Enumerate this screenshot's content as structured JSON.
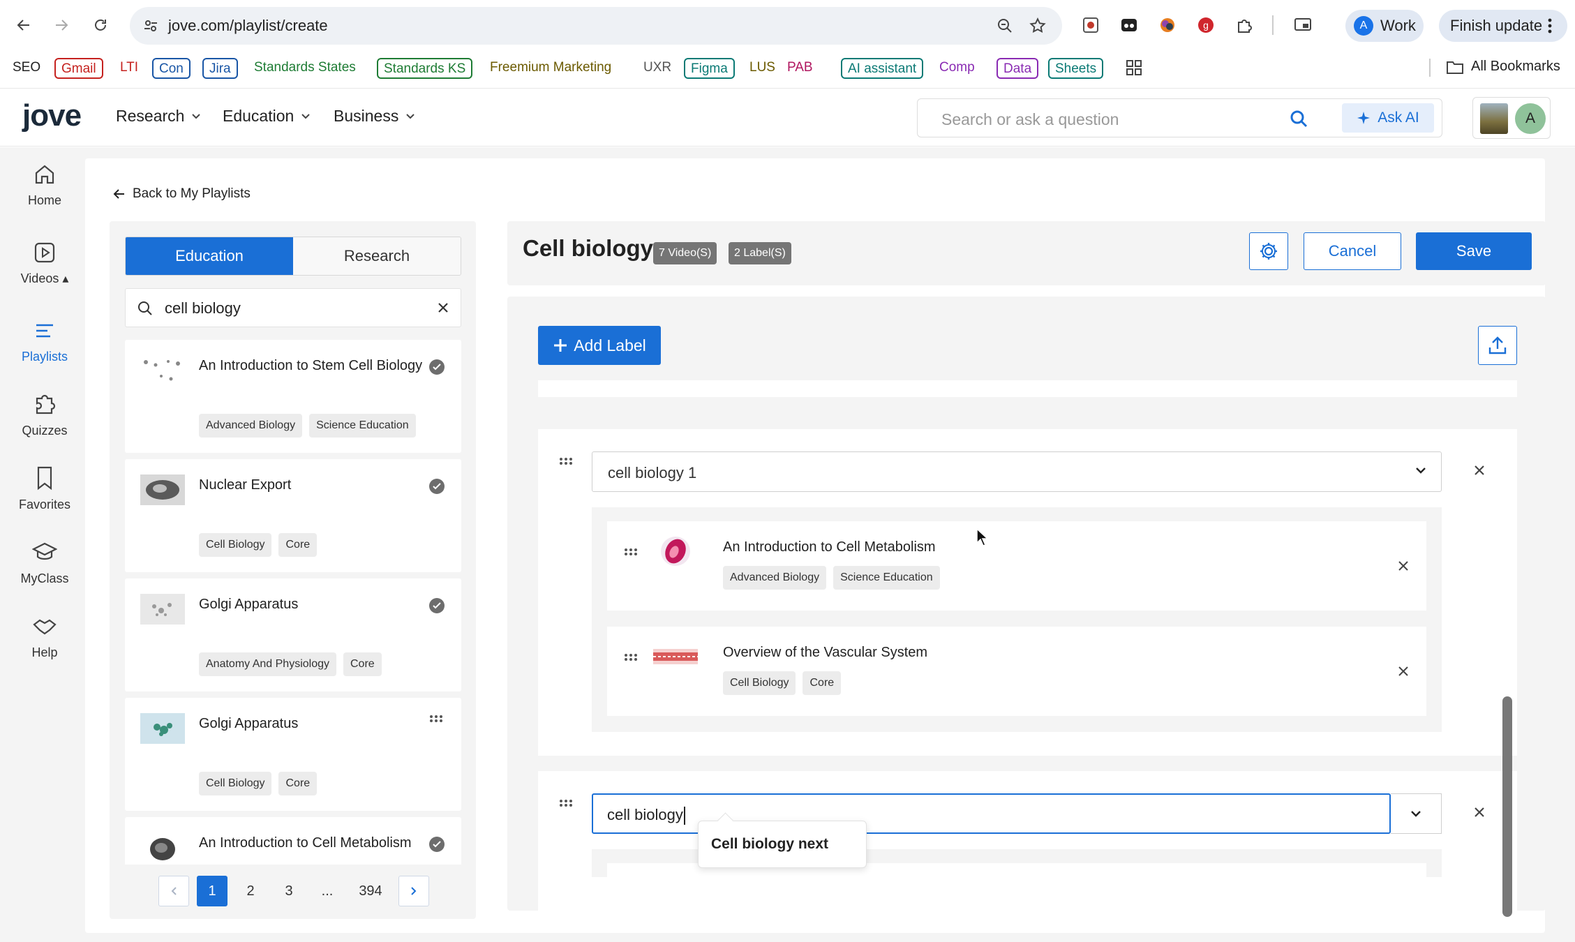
{
  "browser": {
    "url": "jove.com/playlist/create",
    "profile_label": "Work",
    "profile_initial": "A",
    "finish_update_label": "Finish update",
    "all_bookmarks_label": "All Bookmarks",
    "bookmarks": [
      {
        "label": "SEO",
        "color": "#222222",
        "boxed": false
      },
      {
        "label": "Gmail",
        "color": "#c5221f",
        "boxed": true
      },
      {
        "label": "LTI",
        "color": "#c5221f",
        "boxed": false
      },
      {
        "label": "Con",
        "color": "#1a56a6",
        "boxed": true
      },
      {
        "label": "Jira",
        "color": "#1a56a6",
        "boxed": true
      },
      {
        "label": "Standards States",
        "color": "#1e7c34",
        "boxed": false
      },
      {
        "label": "Standards KS",
        "color": "#1e7c34",
        "boxed": true
      },
      {
        "label": "Freemium Marketing",
        "color": "#6b5a00",
        "boxed": false
      },
      {
        "label": "UXR",
        "color": "#555555",
        "boxed": false
      },
      {
        "label": "Figma",
        "color": "#0b7a75",
        "boxed": true
      },
      {
        "label": "LUS",
        "color": "#6b5a00",
        "boxed": false
      },
      {
        "label": "PAB",
        "color": "#b0165f",
        "boxed": false
      },
      {
        "label": "AI assistant",
        "color": "#0b7a75",
        "boxed": true
      },
      {
        "label": "Comp",
        "color": "#8a2bb3",
        "boxed": false
      },
      {
        "label": "Data",
        "color": "#8a2bb3",
        "boxed": true
      },
      {
        "label": "Sheets",
        "color": "#0b7a75",
        "boxed": true
      }
    ]
  },
  "header": {
    "logo": "jove",
    "menus": [
      "Research",
      "Education",
      "Business"
    ],
    "search_placeholder": "Search or ask a question",
    "ask_ai_label": "Ask AI",
    "user_initial": "A"
  },
  "sidenav": [
    {
      "label": "Home",
      "icon": "home-icon"
    },
    {
      "label": "Videos ▴",
      "icon": "video-icon"
    },
    {
      "label": "Playlists",
      "icon": "playlist-icon",
      "active": true
    },
    {
      "label": "Quizzes",
      "icon": "puzzle-icon"
    },
    {
      "label": "Favorites",
      "icon": "bookmark-icon"
    },
    {
      "label": "MyClass",
      "icon": "graduation-cap-icon"
    },
    {
      "label": "Help",
      "icon": "handshake-icon"
    }
  ],
  "back_label": "Back to My Playlists",
  "library": {
    "tabs": [
      "Education",
      "Research"
    ],
    "active_tab": "Education",
    "search_value": "cell biology",
    "videos": [
      {
        "title": "An Introduction to Stem Cell Biology",
        "tags": [
          "Advanced Biology",
          "Science Education"
        ],
        "state": "added"
      },
      {
        "title": "Nuclear Export",
        "tags": [
          "Cell Biology",
          "Core"
        ],
        "state": "added"
      },
      {
        "title": "Golgi Apparatus",
        "tags": [
          "Anatomy And Physiology",
          "Core"
        ],
        "state": "added"
      },
      {
        "title": "Golgi Apparatus",
        "tags": [
          "Cell Biology",
          "Core"
        ],
        "state": "draggable"
      },
      {
        "title": "An Introduction to Cell Metabolism",
        "tags": [],
        "state": "added"
      }
    ],
    "pagination": {
      "pages": [
        "1",
        "2",
        "3",
        "...",
        "394"
      ],
      "current": "1"
    }
  },
  "playlist": {
    "title": "Cell biology",
    "video_count": "7 Video(S)",
    "label_count": "2 Label(S)",
    "cancel_label": "Cancel",
    "save_label": "Save",
    "add_label": "Add Label",
    "groups": [
      {
        "label": "cell biology 1",
        "items": [
          {
            "title": "An Introduction to Cell Metabolism",
            "tags": [
              "Advanced Biology",
              "Science Education"
            ]
          },
          {
            "title": "Overview of the Vascular System",
            "tags": [
              "Cell Biology",
              "Core"
            ]
          }
        ]
      },
      {
        "label_input": "cell biology",
        "suggestion": "Cell biology next"
      }
    ]
  },
  "colors": {
    "accent": "#1a6fd6",
    "panel_bg": "#f4f4f4"
  }
}
